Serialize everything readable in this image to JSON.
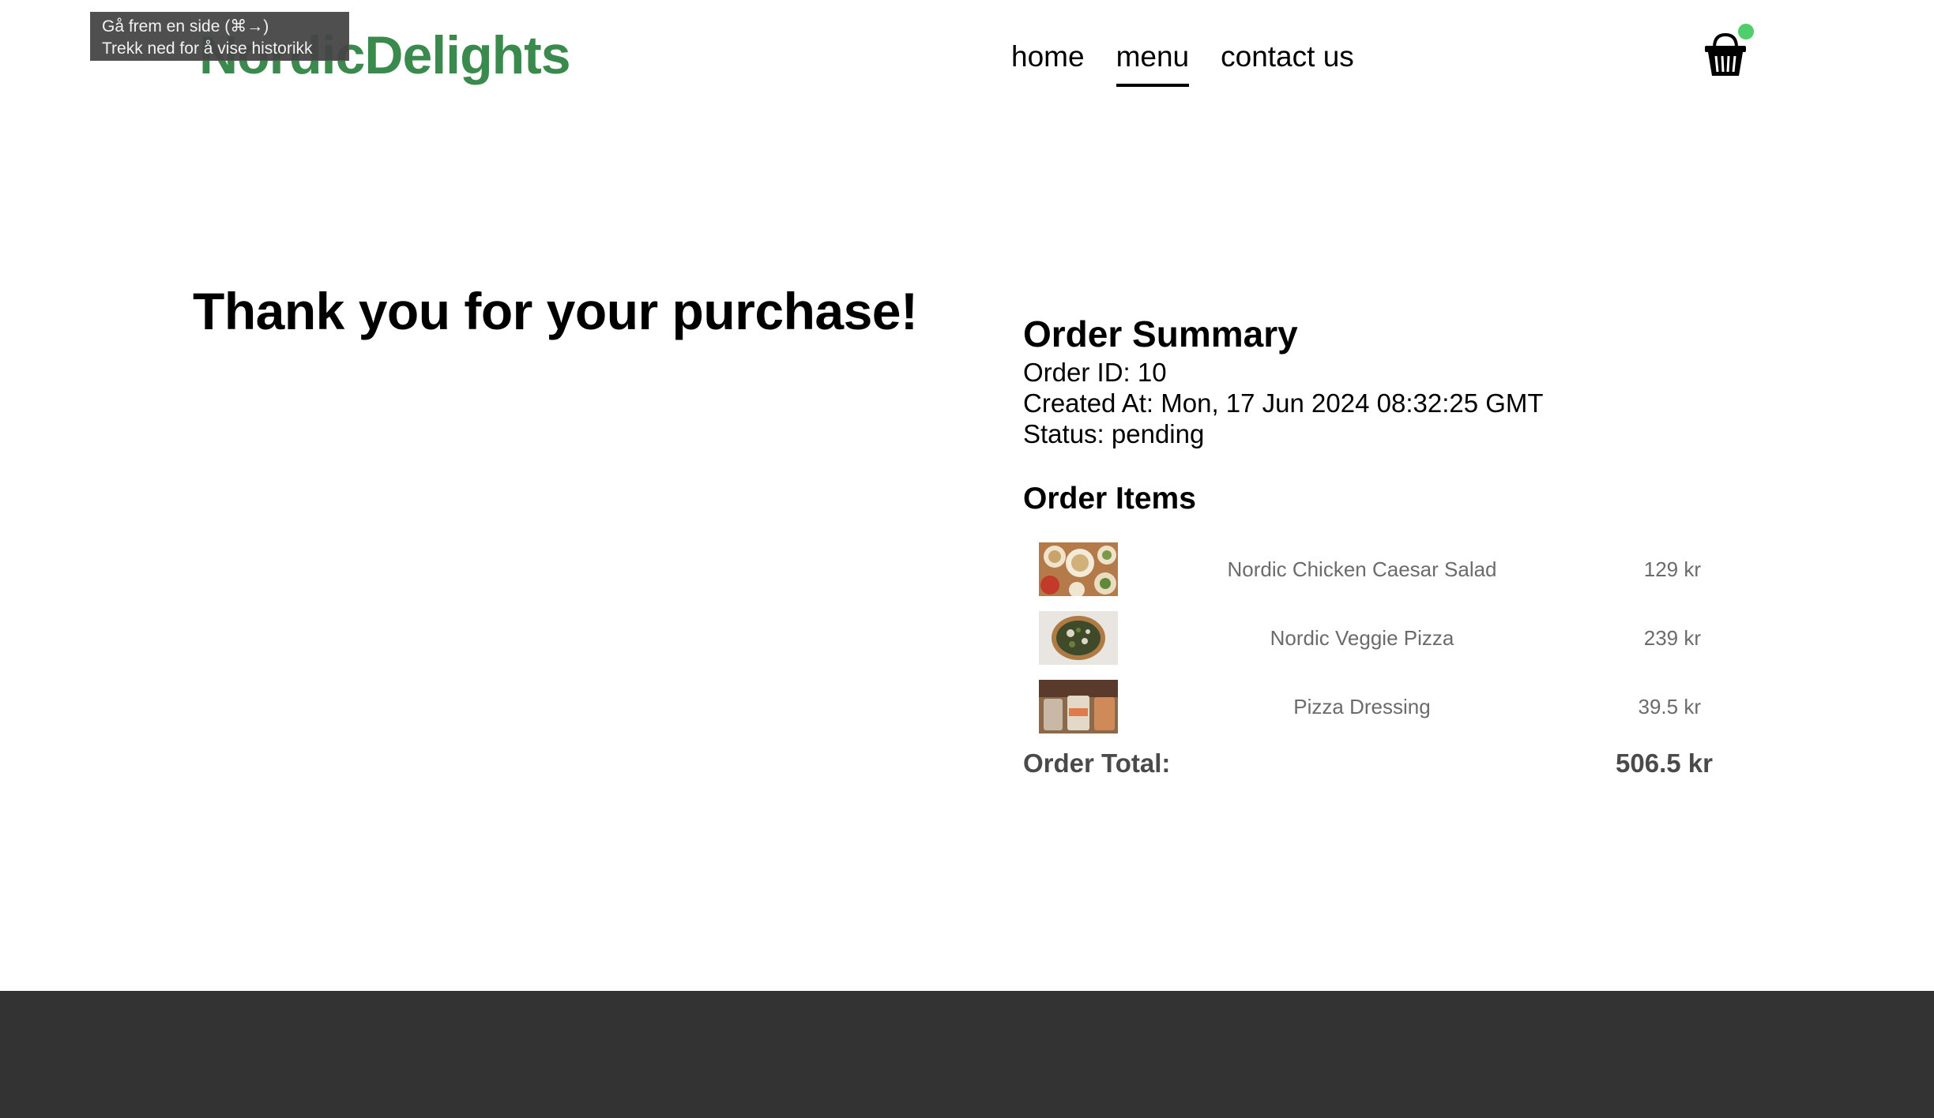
{
  "header": {
    "logo": "NordicDelights",
    "nav": [
      "home",
      "menu",
      "contact us"
    ],
    "active_nav": "menu"
  },
  "tooltip": {
    "line1": "Gå frem en side (⌘→)",
    "line2": "Trekk ned for å vise historikk"
  },
  "main": {
    "heading": "Thank you for your purchase!"
  },
  "order": {
    "title": "Order Summary",
    "id_line": "Order ID: 10",
    "created_line": "Created At: Mon, 17 Jun 2024 08:32:25 GMT",
    "status_line": "Status: pending",
    "items_title": "Order Items",
    "items": [
      {
        "name": "Nordic Chicken Caesar Salad",
        "price": "129 kr"
      },
      {
        "name": "Nordic Veggie Pizza",
        "price": "239 kr"
      },
      {
        "name": "Pizza Dressing",
        "price": "39.5 kr"
      }
    ],
    "total_label": "Order Total:",
    "total_value": "506.5 kr"
  },
  "colors": {
    "brand": "#3a8a4e",
    "cart_badge": "#4fce6a",
    "footer": "#333333"
  },
  "icons": {
    "cart": "basket-icon"
  }
}
